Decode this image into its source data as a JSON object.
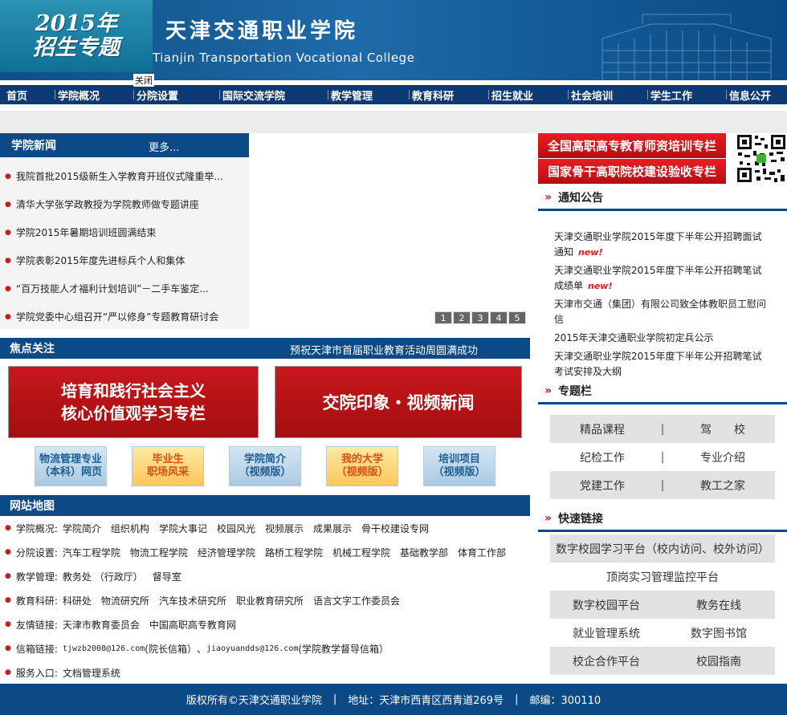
{
  "header": {
    "promo_year": "2015年",
    "promo_title": "招生专题",
    "close_label": "关闭",
    "cn_name": "天津交通职业学院",
    "en_name": "Tianjin Transportation Vocational College"
  },
  "nav": [
    "首页",
    "学院概况",
    "分院设置",
    "国际交流学院",
    "教学管理",
    "教育科研",
    "招生就业",
    "社会培训",
    "学生工作",
    "信息公开"
  ],
  "news": {
    "title": "学院新闻",
    "more": "更多...",
    "items": [
      "我院首批2015级新生入学教育开班仪式隆重举...",
      "清华大学张学政教授为学院教师做专题讲座",
      "学院2015年暑期培训班圆满结束",
      "学院表彰2015年度先进标兵个人和集体",
      "“百万技能人才福利计划培训”－二手车鉴定...",
      "学院党委中心组召开“严以修身”专题教育研讨会"
    ]
  },
  "slider_pages": [
    "1",
    "2",
    "3",
    "4",
    "5"
  ],
  "focus": {
    "title": "焦点关注",
    "marquee": "预祝天津市首届职业教育活动周圆满成功",
    "banner_values_1": "培育和践行社会主义",
    "banner_values_2": "核心价值观学习专栏",
    "banner_video": "交院印象・视频新闻",
    "buttons": [
      {
        "l1": "物流管理专业",
        "l2": "（本科）网页",
        "style": "blue"
      },
      {
        "l1": "毕业生",
        "l2": "职场风采",
        "style": "orange"
      },
      {
        "l1": "学院简介",
        "l2": "（视频版）",
        "style": "blue"
      },
      {
        "l1": "我的大学",
        "l2": "（视频版）",
        "style": "orange"
      },
      {
        "l1": "培训项目",
        "l2": "（视频版）",
        "style": "blue"
      }
    ]
  },
  "sitemap": {
    "title": "网站地图",
    "rows": [
      {
        "label": "学院概况:",
        "links": [
          "学院简介",
          "组织机构",
          "学院大事记",
          "校园风光",
          "视频展示",
          "成果展示",
          "骨干校建设专网"
        ]
      },
      {
        "label": "分院设置:",
        "links": [
          "汽车工程学院",
          "物流工程学院",
          "经济管理学院",
          "路桥工程学院",
          "机械工程学院",
          "基础教学部",
          "体育工作部"
        ]
      },
      {
        "label": "教学管理:",
        "links": [
          "教务处 （行政厅）",
          "督导室"
        ]
      },
      {
        "label": "教育科研:",
        "links": [
          "科研处",
          "物流研究所",
          "汽车技术研究所",
          "职业教育研究所",
          "语言文字工作委员会"
        ]
      },
      {
        "label": "友情链接:",
        "links": [
          "天津市教育委员会",
          "中国高职高专教育网"
        ]
      },
      {
        "label": "信箱链接:",
        "email1": "tjwzb2008@126.com",
        "email1_note": "(院长信箱）",
        "joiner": "、",
        "email2": "jiaoyuandds@126.com",
        "email2_note": "(学院教学督导信箱）"
      },
      {
        "label": "服务入口:",
        "links": [
          "文档管理系统"
        ]
      }
    ]
  },
  "right": {
    "banner1": "全国高职高专教育师资培训专栏",
    "banner2": "国家骨干高职院校建设验收专栏",
    "notice_title": "通知公告",
    "notices": [
      {
        "text": "天津交通职业学院2015年度下半年公开招聘面试通知",
        "new": "new!"
      },
      {
        "text": "天津交通职业学院2015年度下半年公开招聘笔试成绩单",
        "new": "new!"
      },
      {
        "text": "天津市交通（集团）有限公司致全体教职员工慰问信",
        "new": ""
      },
      {
        "text": "2015年天津交通职业学院初定兵公示",
        "new": ""
      },
      {
        "text": "天津交通职业学院2015年度下半年公开招聘笔试考试安排及大纲",
        "new": ""
      }
    ],
    "topic_title": "专题栏",
    "topics": [
      [
        "精品课程",
        "驾　　校"
      ],
      [
        "纪检工作",
        "专业介绍"
      ],
      [
        "党建工作",
        "教工之家"
      ]
    ],
    "quick_title": "快速链接",
    "quick": [
      [
        "数字校园学习平台（校内访问、校外访问）"
      ],
      [
        "顶岗实习管理监控平台"
      ],
      [
        "数字校园平台",
        "教务在线"
      ],
      [
        "就业管理系统",
        "数字图书馆"
      ],
      [
        "校企合作平台",
        "校园指南"
      ]
    ]
  },
  "footer": {
    "copyright": "版权所有©天津交通职业学院",
    "address": "地址：天津市西青区西青道269号",
    "postcode": "邮编：300110"
  }
}
